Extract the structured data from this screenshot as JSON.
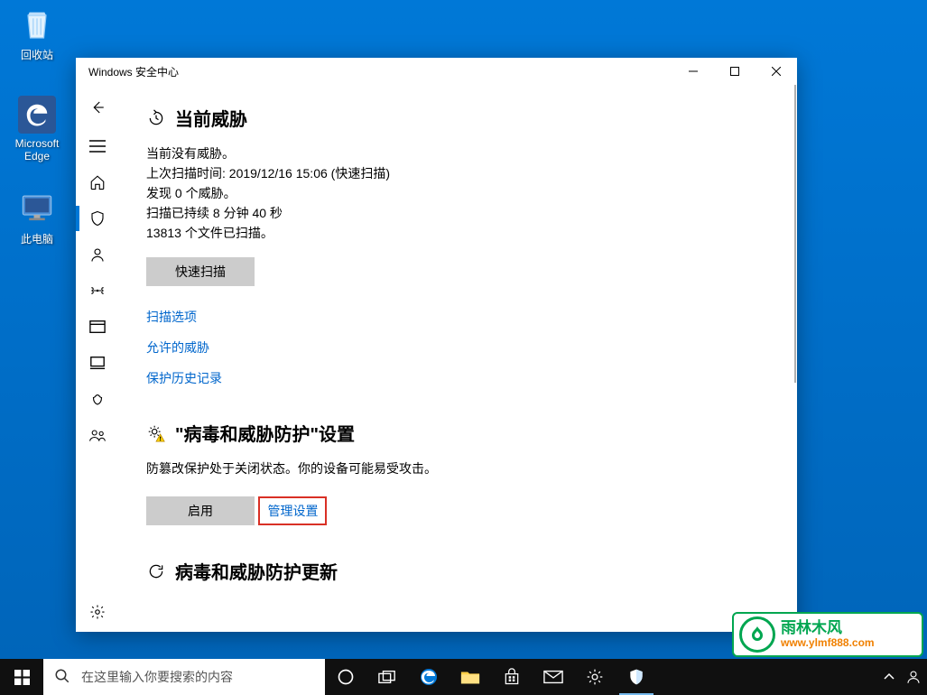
{
  "desktop": {
    "recycle_bin": "回收站",
    "edge": "Microsoft Edge",
    "this_pc": "此电脑"
  },
  "window": {
    "title": "Windows 安全中心"
  },
  "sections": {
    "currentThreats": {
      "title": "当前威胁",
      "noThreats": "当前没有威胁。",
      "lastScan": "上次扫描时间: 2019/12/16 15:06 (快速扫描)",
      "found": "发现 0 个威胁。",
      "duration": "扫描已持续 8 分钟 40 秒",
      "filesScanned": "13813 个文件已扫描。",
      "quickScan": "快速扫描",
      "scanOptions": "扫描选项",
      "allowedThreats": "允许的威胁",
      "protectionHistory": "保护历史记录"
    },
    "protectionSettings": {
      "title": "\"病毒和威胁防护\"设置",
      "desc": "防篡改保护处于关闭状态。你的设备可能易受攻击。",
      "enable": "启用",
      "manageSettings": "管理设置"
    },
    "updates": {
      "title": "病毒和威胁防护更新"
    }
  },
  "taskbar": {
    "search_placeholder": "在这里输入你要搜索的内容"
  },
  "watermark": {
    "brand": "雨林木风",
    "url": "www.ylmf888.com"
  }
}
